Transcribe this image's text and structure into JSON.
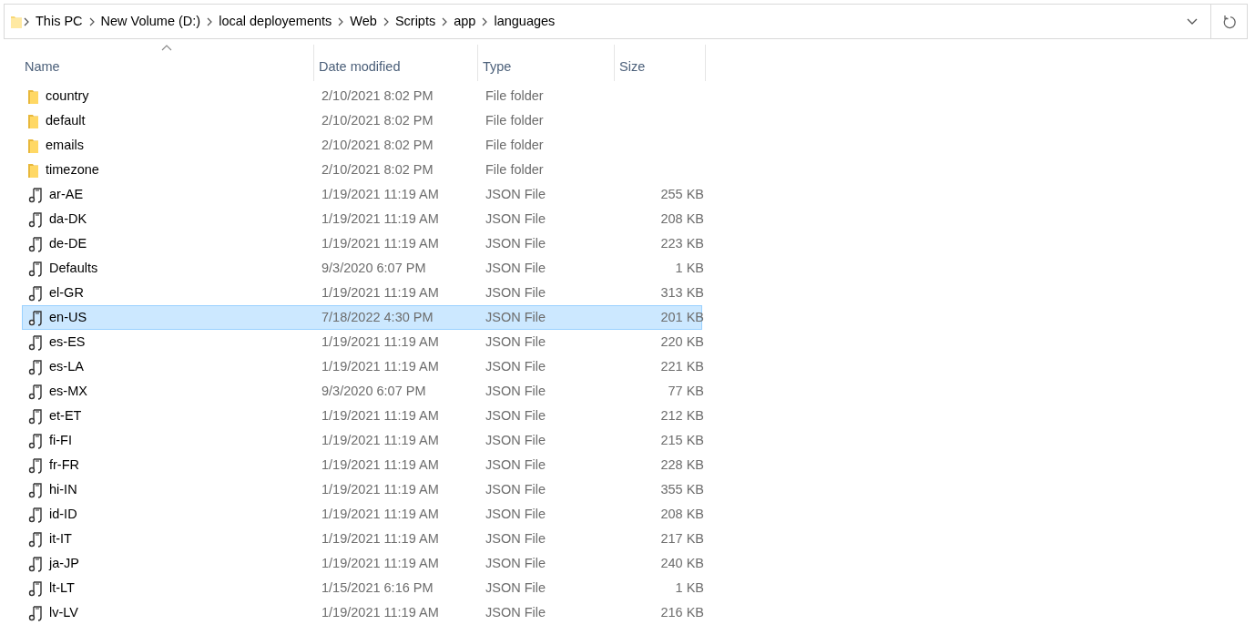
{
  "address_bar": {
    "path": [
      "This PC",
      "New Volume (D:)",
      "local deployements",
      "Web",
      "Scripts",
      "app",
      "languages"
    ]
  },
  "columns": [
    {
      "label": "Name",
      "sorted": true
    },
    {
      "label": "Date modified",
      "sorted": false
    },
    {
      "label": "Type",
      "sorted": false
    },
    {
      "label": "Size",
      "sorted": false
    }
  ],
  "rows": [
    {
      "kind": "folder",
      "name": "country",
      "date": "2/10/2021 8:02 PM",
      "type": "File folder",
      "selected": false
    },
    {
      "kind": "folder",
      "name": "default",
      "date": "2/10/2021 8:02 PM",
      "type": "File folder",
      "selected": false
    },
    {
      "kind": "folder",
      "name": "emails",
      "date": "2/10/2021 8:02 PM",
      "type": "File folder",
      "selected": false
    },
    {
      "kind": "folder",
      "name": "timezone",
      "date": "2/10/2021 8:02 PM",
      "type": "File folder",
      "selected": false
    },
    {
      "kind": "file",
      "name": "ar-AE",
      "date": "1/19/2021 11:19 AM",
      "type": "JSON File",
      "size": "255 KB",
      "selected": false
    },
    {
      "kind": "file",
      "name": "da-DK",
      "date": "1/19/2021 11:19 AM",
      "type": "JSON File",
      "size": "208 KB",
      "selected": false
    },
    {
      "kind": "file",
      "name": "de-DE",
      "date": "1/19/2021 11:19 AM",
      "type": "JSON File",
      "size": "223 KB",
      "selected": false
    },
    {
      "kind": "file",
      "name": "Defaults",
      "date": "9/3/2020 6:07 PM",
      "type": "JSON File",
      "size": "1 KB",
      "selected": false
    },
    {
      "kind": "file",
      "name": "el-GR",
      "date": "1/19/2021 11:19 AM",
      "type": "JSON File",
      "size": "313 KB",
      "selected": false
    },
    {
      "kind": "file",
      "name": "en-US",
      "date": "7/18/2022 4:30 PM",
      "type": "JSON File",
      "size": "201 KB",
      "selected": true
    },
    {
      "kind": "file",
      "name": "es-ES",
      "date": "1/19/2021 11:19 AM",
      "type": "JSON File",
      "size": "220 KB",
      "selected": false
    },
    {
      "kind": "file",
      "name": "es-LA",
      "date": "1/19/2021 11:19 AM",
      "type": "JSON File",
      "size": "221 KB",
      "selected": false
    },
    {
      "kind": "file",
      "name": "es-MX",
      "date": "9/3/2020 6:07 PM",
      "type": "JSON File",
      "size": "77 KB",
      "selected": false
    },
    {
      "kind": "file",
      "name": "et-ET",
      "date": "1/19/2021 11:19 AM",
      "type": "JSON File",
      "size": "212 KB",
      "selected": false
    },
    {
      "kind": "file",
      "name": "fi-FI",
      "date": "1/19/2021 11:19 AM",
      "type": "JSON File",
      "size": "215 KB",
      "selected": false
    },
    {
      "kind": "file",
      "name": "fr-FR",
      "date": "1/19/2021 11:19 AM",
      "type": "JSON File",
      "size": "228 KB",
      "selected": false
    },
    {
      "kind": "file",
      "name": "hi-IN",
      "date": "1/19/2021 11:19 AM",
      "type": "JSON File",
      "size": "355 KB",
      "selected": false
    },
    {
      "kind": "file",
      "name": "id-ID",
      "date": "1/19/2021 11:19 AM",
      "type": "JSON File",
      "size": "208 KB",
      "selected": false
    },
    {
      "kind": "file",
      "name": "it-IT",
      "date": "1/19/2021 11:19 AM",
      "type": "JSON File",
      "size": "217 KB",
      "selected": false
    },
    {
      "kind": "file",
      "name": "ja-JP",
      "date": "1/19/2021 11:19 AM",
      "type": "JSON File",
      "size": "240 KB",
      "selected": false
    },
    {
      "kind": "file",
      "name": "lt-LT",
      "date": "1/15/2021 6:16 PM",
      "type": "JSON File",
      "size": "1 KB",
      "selected": false
    },
    {
      "kind": "file",
      "name": "lv-LV",
      "date": "1/19/2021 11:19 AM",
      "type": "JSON File",
      "size": "216 KB",
      "selected": false
    }
  ]
}
